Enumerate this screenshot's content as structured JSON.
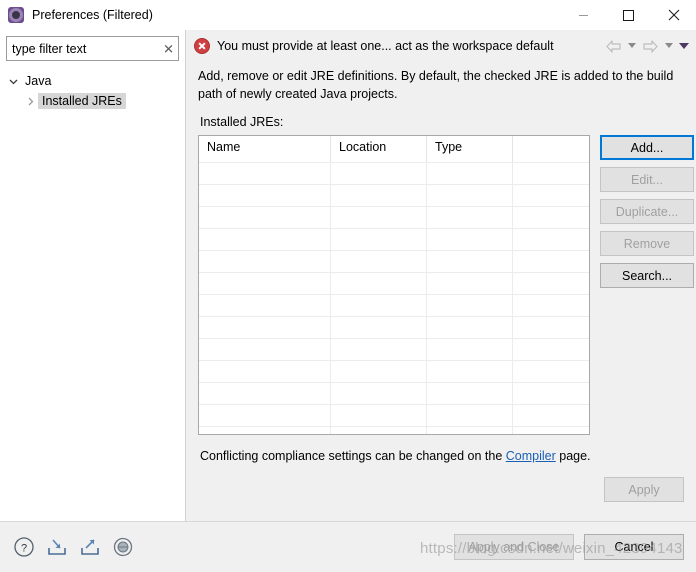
{
  "window": {
    "title": "Preferences (Filtered)",
    "icon": "preferences-gear-icon",
    "minimize_label": "—",
    "maximize_label": "□",
    "close_label": "✕"
  },
  "filter": {
    "value": "type filter text",
    "placeholder": "type filter text",
    "clear_label": "✕"
  },
  "tree": {
    "items": [
      {
        "label": "Java",
        "twisty": "chevron-down-icon",
        "selected": false,
        "indent": 0
      },
      {
        "label": "Installed JREs",
        "twisty": "chevron-right-icon",
        "selected": true,
        "indent": 1
      }
    ]
  },
  "message_bar": {
    "icon": "error-icon",
    "text": "You must provide at least one... act as the workspace default",
    "nav": {
      "back_label": "back-arrow-icon",
      "back_caret_label": "chevron-down-icon",
      "forward_label": "forward-arrow-icon",
      "forward_caret_label": "chevron-down-icon",
      "menu_caret_label": "chevron-down-filled-icon"
    }
  },
  "page": {
    "description": "Add, remove or edit JRE definitions. By default, the checked JRE is added to the build path of newly created Java projects.",
    "table_label": "Installed JREs:",
    "table": {
      "columns": [
        "Name",
        "Location",
        "Type",
        ""
      ],
      "rows": [],
      "empty_row_count": 13
    },
    "buttons": [
      {
        "label": "Add...",
        "state": "focused"
      },
      {
        "label": "Edit...",
        "state": "disabled"
      },
      {
        "label": "Duplicate...",
        "state": "disabled"
      },
      {
        "label": "Remove",
        "state": "disabled"
      },
      {
        "label": "Search...",
        "state": "enabled"
      }
    ],
    "footer_note": {
      "prefix": "Conflicting compliance settings can be changed on the ",
      "link": "Compiler",
      "suffix": " page."
    },
    "apply": {
      "label": "Apply",
      "state": "disabled"
    }
  },
  "bottom_bar": {
    "icons": [
      {
        "name": "help-icon"
      },
      {
        "name": "import-preferences-icon"
      },
      {
        "name": "export-preferences-icon"
      },
      {
        "name": "restore-defaults-icon"
      }
    ],
    "apply_and_close": {
      "label": "Apply and Close",
      "state": "disabled"
    },
    "cancel": {
      "label": "Cancel",
      "state": "enabled"
    }
  },
  "watermark": "https://blog.csdn.net/weixin_42394143",
  "colors": {
    "accent_focus": "#0078d7",
    "error": "#cf4040",
    "link": "#1a5fb4",
    "dialog_bg": "#f0f0f0",
    "selection": "#d6d6d6"
  }
}
